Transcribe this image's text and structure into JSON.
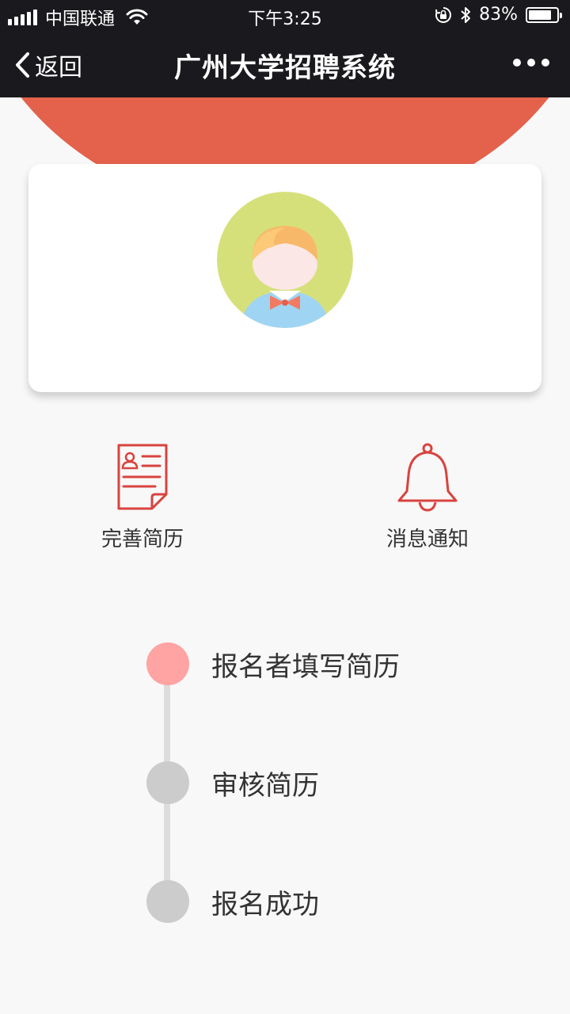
{
  "status_bar": {
    "carrier": "中国联通",
    "time": "下午3:25",
    "battery_percent": "83%",
    "battery_level": 0.83
  },
  "nav": {
    "back_label": "返回",
    "title": "广州大学招聘系统"
  },
  "colors": {
    "header_red": "#e4614b",
    "accent_red": "#d9433f",
    "step_active": "#ffa3a3",
    "step_inactive": "#cccccc"
  },
  "actions": [
    {
      "label": "完善简历",
      "icon": "resume-document-icon"
    },
    {
      "label": "消息通知",
      "icon": "bell-icon"
    }
  ],
  "steps": [
    {
      "label": "报名者填写简历",
      "active": true
    },
    {
      "label": "审核简历",
      "active": false
    },
    {
      "label": "报名成功",
      "active": false
    }
  ]
}
